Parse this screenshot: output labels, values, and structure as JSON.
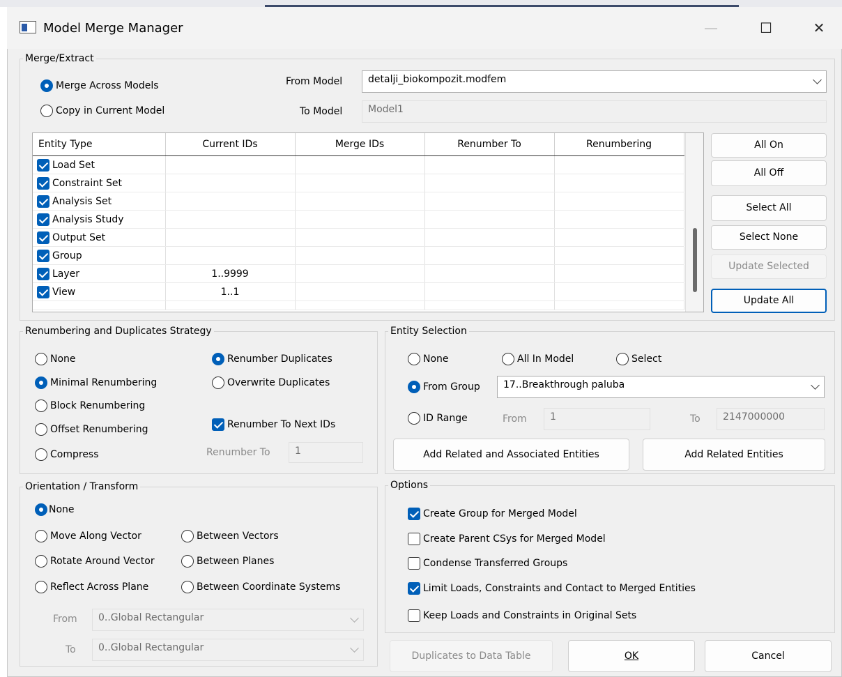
{
  "window": {
    "title": "Model Merge Manager",
    "minimize": "—",
    "maximize": "☐",
    "close": "✕"
  },
  "merge": {
    "legend": "Merge/Extract",
    "merge_across": "Merge Across Models",
    "copy_current": "Copy in Current Model",
    "from_model_label": "From Model",
    "from_model_value": "detalji_biokompozit.modfem",
    "to_model_label": "To Model",
    "to_model_value": "Model1"
  },
  "table": {
    "headers": [
      "Entity Type",
      "Current IDs",
      "Merge IDs",
      "Renumber To",
      "Renumbering"
    ],
    "rows": [
      {
        "name": "Load Set",
        "current": ""
      },
      {
        "name": "Constraint Set",
        "current": ""
      },
      {
        "name": "Analysis Set",
        "current": ""
      },
      {
        "name": "Analysis Study",
        "current": ""
      },
      {
        "name": "Output Set",
        "current": ""
      },
      {
        "name": "Group",
        "current": ""
      },
      {
        "name": "Layer",
        "current": "1..9999"
      },
      {
        "name": "View",
        "current": "1..1"
      }
    ]
  },
  "side_buttons": {
    "all_on": "All On",
    "all_off": "All Off",
    "select_all": "Select All",
    "select_none": "Select None",
    "update_selected": "Update Selected",
    "update_all": "Update All"
  },
  "renumbering": {
    "legend": "Renumbering and Duplicates Strategy",
    "none": "None",
    "minimal": "Minimal Renumbering",
    "block": "Block Renumbering",
    "offset": "Offset Renumbering",
    "compress": "Compress",
    "renumber_dups": "Renumber Duplicates",
    "overwrite_dups": "Overwrite Duplicates",
    "renumber_next": "Renumber To Next IDs",
    "renumber_to_label": "Renumber To",
    "renumber_to_value": "1"
  },
  "entity_selection": {
    "legend": "Entity Selection",
    "none": "None",
    "all_in_model": "All In Model",
    "select": "Select",
    "from_group": "From Group",
    "group_value": "17..Breakthrough paluba",
    "id_range": "ID Range",
    "from_label": "From",
    "from_value": "1",
    "to_label": "To",
    "to_value": "2147000000",
    "add_related_assoc": "Add Related and Associated Entities",
    "add_related": "Add Related Entities"
  },
  "orientation": {
    "legend": "Orientation / Transform",
    "none": "None",
    "move_vector": "Move Along Vector",
    "between_vectors": "Between Vectors",
    "rotate_vector": "Rotate Around Vector",
    "between_planes": "Between Planes",
    "reflect_plane": "Reflect Across Plane",
    "between_csys": "Between Coordinate Systems",
    "from_label": "From",
    "from_value": "0..Global Rectangular",
    "to_label": "To",
    "to_value": "0..Global Rectangular"
  },
  "options": {
    "legend": "Options",
    "create_group": "Create Group for Merged Model",
    "create_parent_csys": "Create Parent CSys for Merged Model",
    "condense_groups": "Condense Transferred Groups",
    "limit_loads": "Limit Loads, Constraints and Contact to Merged Entities",
    "keep_loads": "Keep Loads and Constraints in Original Sets"
  },
  "footer": {
    "dup_table": "Duplicates to Data Table",
    "ok": "OK",
    "cancel": "Cancel"
  },
  "colors": {
    "accent": "#005fb8",
    "window_bg": "#f0f0f0"
  }
}
